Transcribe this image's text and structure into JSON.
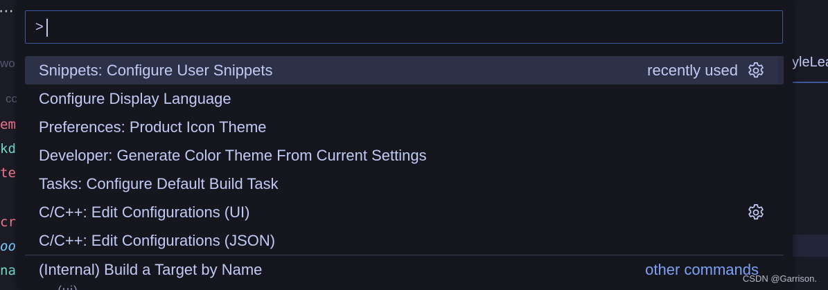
{
  "background": {
    "overflow_dots": "⋯",
    "left_fragments": [
      {
        "text": "wo",
        "color": "#565a72",
        "kind": "label"
      },
      {
        "text": "cc",
        "color": "#565a72",
        "kind": "label"
      },
      {
        "text": "em",
        "color": "#f7768e",
        "kind": "code"
      },
      {
        "text": "kd",
        "color": "#73daca",
        "kind": "code"
      },
      {
        "text": "te",
        "color": "#f7768e",
        "kind": "code"
      },
      {
        "text": "cr",
        "color": "#f7768e",
        "kind": "code"
      },
      {
        "text": "oo",
        "color": "#7dcfff",
        "kind": "code-italic"
      },
      {
        "text": "na",
        "color": "#73daca",
        "kind": "code"
      }
    ],
    "right_tab_text": "yleLea"
  },
  "quick_input": {
    "value": ">",
    "items": [
      {
        "label": "Snippets: Configure User Snippets",
        "description": "recently used",
        "icon": "gear-icon",
        "focused": true
      },
      {
        "label": "Configure Display Language"
      },
      {
        "label": "Preferences: Product Icon Theme"
      },
      {
        "label": "Developer: Generate Color Theme From Current Settings"
      },
      {
        "label": "Tasks: Configure Default Build Task"
      },
      {
        "label": "C/C++: Edit Configurations (UI)",
        "icon": "gear-icon"
      },
      {
        "label": "C/C++: Edit Configurations (JSON)"
      },
      {
        "label": "(Internal) Build a Target by Name",
        "link": "other commands",
        "separated": true
      }
    ],
    "partial_next_row": "··· (ui) ···"
  },
  "watermark": "CSDN @Garrison.",
  "colors": {
    "widget_bg": "#16161e",
    "focus_row": "#2c3147",
    "input_border": "#3d59a1",
    "text": "#c0caf5",
    "link": "#7aa2f7"
  }
}
